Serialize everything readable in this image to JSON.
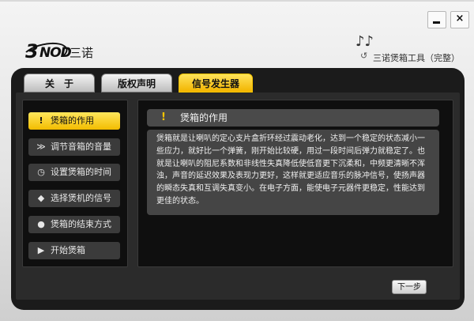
{
  "window": {
    "minimize_label": "–",
    "close_label": "×"
  },
  "brand": {
    "logo_number": "3",
    "logo_text": "NOD",
    "logo_cn": "三诺"
  },
  "app": {
    "notes_icon": "♪♪",
    "title": "三诺煲箱工具（完整）"
  },
  "tabs": [
    {
      "label": "关　于",
      "active": false
    },
    {
      "label": "版权声明",
      "active": false
    },
    {
      "label": "信号发生器",
      "active": true
    }
  ],
  "sidebar": {
    "items": [
      {
        "icon": "!",
        "label": "煲箱的作用",
        "active": true
      },
      {
        "icon": "≫",
        "label": "调节音箱的音量",
        "active": false
      },
      {
        "icon": "◷",
        "label": "设置煲箱的时间",
        "active": false
      },
      {
        "icon": "◆",
        "label": "选择煲机的信号",
        "active": false
      },
      {
        "icon": "●",
        "label": "煲箱的结束方式",
        "active": false
      },
      {
        "icon": "▶",
        "label": "开始煲箱",
        "active": false
      }
    ]
  },
  "detail": {
    "title": "煲箱的作用",
    "body": "煲箱就是让喇叭的定心支片盒折环经过震动老化，达到一个稳定的状态减小一些应力，就好比一个弹簧，刚开始比较硬，用过一段时间后弹力就稳定了。也就是让喇叭的阻尼系数和非线性失真降低使低音更下沉柔和，中频更清晰不浑浊，声音的延迟效果及表现力更好，这样就更适应音乐的脉冲信号，使扬声器的瞬态失真和互调失真变小。在电子方面，能使电子元器件更稳定，性能达到更佳的状态。"
  },
  "footer": {
    "next_label": "下一步"
  },
  "colors": {
    "accent": "#f6c400",
    "panel": "#1b1b1b"
  }
}
